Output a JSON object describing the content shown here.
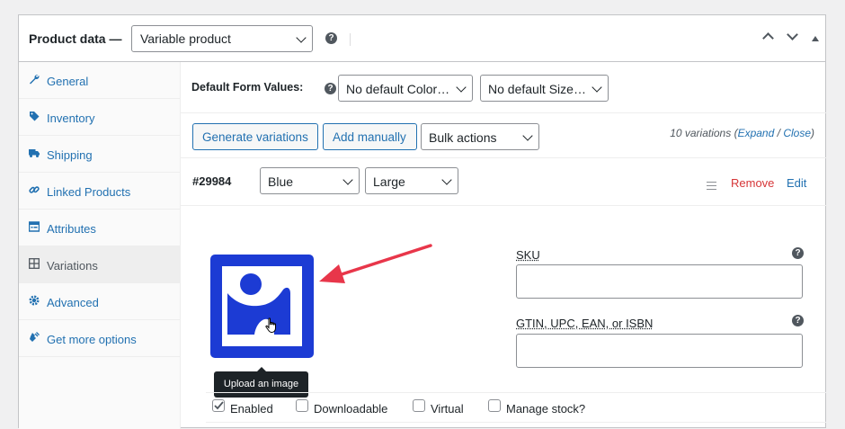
{
  "header": {
    "title": "Product data —",
    "product_type": "Variable product"
  },
  "sidebar": {
    "items": [
      {
        "label": "General",
        "icon": "wrench-icon"
      },
      {
        "label": "Inventory",
        "icon": "tag-icon"
      },
      {
        "label": "Shipping",
        "icon": "truck-icon"
      },
      {
        "label": "Linked Products",
        "icon": "link-icon"
      },
      {
        "label": "Attributes",
        "icon": "list-icon"
      },
      {
        "label": "Variations",
        "icon": "grid-icon",
        "active": true
      },
      {
        "label": "Advanced",
        "icon": "gear-icon"
      },
      {
        "label": "Get more options",
        "icon": "plugin-icon"
      }
    ]
  },
  "defaults": {
    "label": "Default Form Values:",
    "color_select": "No default Color…",
    "size_select": "No default Size…"
  },
  "actions": {
    "generate": "Generate variations",
    "add_manually": "Add manually",
    "bulk": "Bulk actions",
    "count": "10 variations",
    "expand": "Expand",
    "slash": "/",
    "close": "Close"
  },
  "variation": {
    "id": "#29984",
    "color": "Blue",
    "size": "Large",
    "remove": "Remove",
    "edit": "Edit",
    "tooltip": "Upload an image",
    "sku_label": "SKU",
    "gtin_label": "GTIN, UPC, EAN, or ISBN",
    "checks": {
      "enabled": "Enabled",
      "downloadable": "Downloadable",
      "virtual": "Virtual",
      "manage_stock": "Manage stock?"
    },
    "enabled_checked": true
  },
  "colors": {
    "accent": "#2271b1",
    "image_blue": "#1c3bd4",
    "arrow": "#e8364a",
    "remove": "#d63638"
  }
}
